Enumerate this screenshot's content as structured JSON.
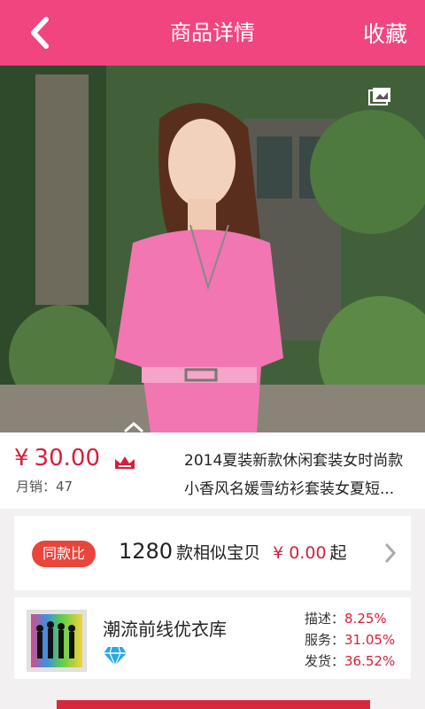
{
  "header": {
    "title": "商品详情",
    "favorite_label": "收藏"
  },
  "product": {
    "currency": "¥",
    "price": "30.00",
    "monthly_sales_label": "月销：",
    "monthly_sales": "47",
    "name_line1": "2014夏装新款休闲套装女时尚款",
    "name_line2": "小香风名媛雪纺衫套装女夏短..."
  },
  "compare": {
    "badge": "同款比",
    "count": "1280",
    "text": "款相似宝贝",
    "price": "¥ 0.00",
    "suffix": "起"
  },
  "shop": {
    "name": "潮流前线优衣库",
    "ratings": [
      {
        "label": "描述：",
        "value": "8.25%"
      },
      {
        "label": "服务：",
        "value": "31.05%"
      },
      {
        "label": "发货：",
        "value": "36.52%"
      }
    ]
  },
  "colors": {
    "accent": "#f0457f",
    "price": "#d81e3c",
    "badge": "#e8463c"
  },
  "icons": [
    "back-icon",
    "gallery-icon",
    "crown-icon",
    "chevron-right-icon",
    "diamond-icon",
    "pull-up-icon"
  ]
}
